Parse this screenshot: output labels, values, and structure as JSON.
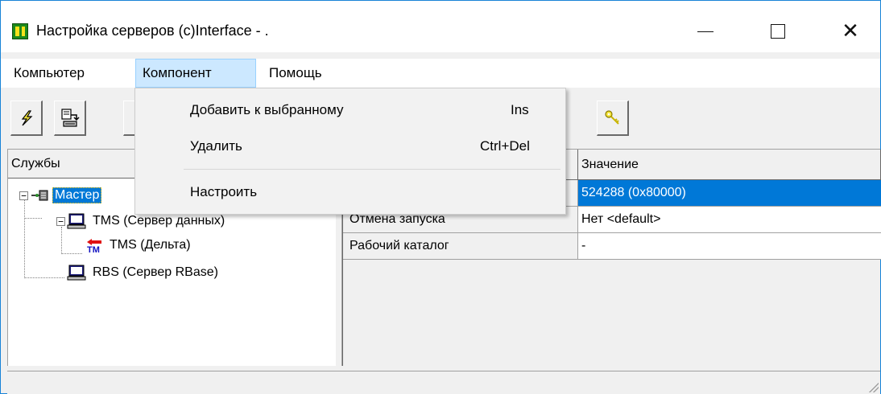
{
  "window": {
    "title": "Настройка серверов (c)Interface - ."
  },
  "menubar": {
    "items": [
      {
        "label": "Компьютер"
      },
      {
        "label": "Компонент"
      },
      {
        "label": "Помощь"
      }
    ]
  },
  "dropdown": {
    "items": [
      {
        "label": "Добавить к выбранному",
        "shortcut": "Ins"
      },
      {
        "label": "Удалить",
        "shortcut": "Ctrl+Del"
      },
      {
        "label": "Настроить",
        "shortcut": ""
      }
    ]
  },
  "toolbar": {
    "buttons": [
      {
        "icon": "lightning-icon"
      },
      {
        "icon": "export-icon"
      },
      {
        "icon": "toolbar-button-icon"
      },
      {
        "icon": "key-icon"
      }
    ]
  },
  "tree": {
    "header": "Службы",
    "nodes": [
      {
        "label": "Мастер",
        "icon": "network-icon",
        "selected": true
      },
      {
        "label": "TMS (Сервер данных)",
        "icon": "computer-icon"
      },
      {
        "label": "TMS (Дельта)",
        "icon": "tm-icon",
        "icon_text": "TM"
      },
      {
        "label": "RBS (Сервер RBase)",
        "icon": "computer-icon"
      }
    ]
  },
  "grid": {
    "columns": [
      "",
      "Значение"
    ],
    "rows": [
      {
        "name": "",
        "value": "524288 (0x80000)",
        "selected": true
      },
      {
        "name": "Отмена запуска",
        "value": "Нет <default>"
      },
      {
        "name": "Рабочий каталог",
        "value": "-"
      }
    ]
  },
  "colors": {
    "selection": "#0078d7",
    "menu_highlight": "#cce8ff",
    "tm_icon_red": "#e01010",
    "tm_icon_blue": "#1010c0"
  }
}
